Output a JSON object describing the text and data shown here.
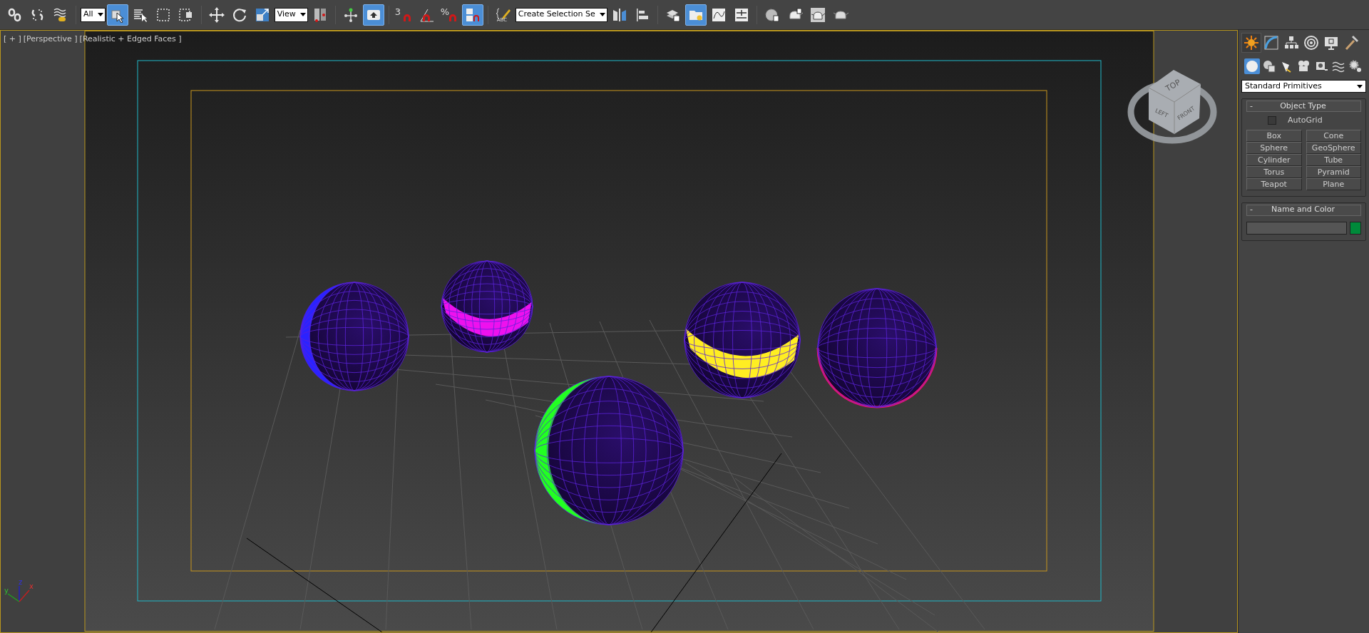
{
  "toolbar": [
    {
      "kind": "icon",
      "selected": false
    },
    {
      "kind": "icon",
      "selected": false
    },
    {
      "kind": "icon",
      "selected": false
    },
    {
      "kind": "separator"
    },
    {
      "kind": "dropdown",
      "value": "All"
    },
    {
      "kind": "icon",
      "selected": true
    },
    {
      "kind": "icon",
      "selected": false
    },
    {
      "kind": "icon",
      "selected": false
    },
    {
      "kind": "icon",
      "selected": false
    },
    {
      "kind": "separator"
    },
    {
      "kind": "icon",
      "selected": false
    },
    {
      "kind": "icon",
      "selected": false
    },
    {
      "kind": "icon",
      "selected": false
    },
    {
      "kind": "dropdown",
      "value": "View"
    },
    {
      "kind": "icon",
      "selected": false
    },
    {
      "kind": "separator"
    },
    {
      "kind": "icon",
      "selected": false
    },
    {
      "kind": "icon",
      "selected": true
    },
    {
      "kind": "separator"
    },
    {
      "kind": "icon",
      "selected": false,
      "label": "3"
    },
    {
      "kind": "icon",
      "selected": false
    },
    {
      "kind": "icon",
      "selected": false,
      "label": "%"
    },
    {
      "kind": "icon",
      "selected": true
    },
    {
      "kind": "separator"
    },
    {
      "kind": "icon",
      "selected": false,
      "label": "ABC"
    },
    {
      "kind": "dropdown",
      "value": "Create Selection Se"
    },
    {
      "kind": "icon",
      "selected": false
    },
    {
      "kind": "icon",
      "selected": false
    },
    {
      "kind": "separator"
    },
    {
      "kind": "icon",
      "selected": false
    },
    {
      "kind": "icon",
      "selected": true
    },
    {
      "kind": "icon",
      "selected": false
    },
    {
      "kind": "icon",
      "selected": false
    },
    {
      "kind": "separator"
    },
    {
      "kind": "icon",
      "selected": false
    },
    {
      "kind": "icon",
      "selected": false
    },
    {
      "kind": "icon",
      "selected": false
    },
    {
      "kind": "icon",
      "selected": false
    }
  ],
  "viewport": {
    "labels": [
      "[ + ]",
      "[Perspective ]",
      "[Realistic + Edged Faces ]"
    ],
    "viewcube": {
      "top": "TOP",
      "left": "LEFT",
      "front": "FRONT"
    },
    "axes": {
      "x": "x",
      "y": "y",
      "z": "z"
    },
    "spheres": [
      {
        "kind": "crescent",
        "color": "#2b22ff"
      },
      {
        "kind": "band",
        "color": "#ee11ee"
      },
      {
        "kind": "crescent",
        "color": "#22ff22"
      },
      {
        "kind": "band",
        "color": "#ffee22"
      },
      {
        "kind": "rim",
        "color": "#ff1166"
      }
    ]
  },
  "command_panel": {
    "tabs": [
      {
        "selected": true
      },
      {
        "selected": false
      },
      {
        "selected": false
      },
      {
        "selected": false
      },
      {
        "selected": false
      },
      {
        "selected": false
      }
    ],
    "categories": [
      {
        "selected": true
      },
      {
        "selected": false
      },
      {
        "selected": false
      },
      {
        "selected": false
      },
      {
        "selected": false
      },
      {
        "selected": false
      },
      {
        "selected": false
      }
    ],
    "dropdown": "Standard Primitives",
    "object_type": {
      "title": "Object Type",
      "collapse": "-",
      "autogrid": {
        "label": "AutoGrid",
        "checked": false
      },
      "buttons": [
        "Box",
        "Cone",
        "Sphere",
        "GeoSphere",
        "Cylinder",
        "Tube",
        "Torus",
        "Pyramid",
        "Teapot",
        "Plane"
      ]
    },
    "name_and_color": {
      "title": "Name and Color",
      "collapse": "-",
      "color": "#008a3a"
    }
  }
}
